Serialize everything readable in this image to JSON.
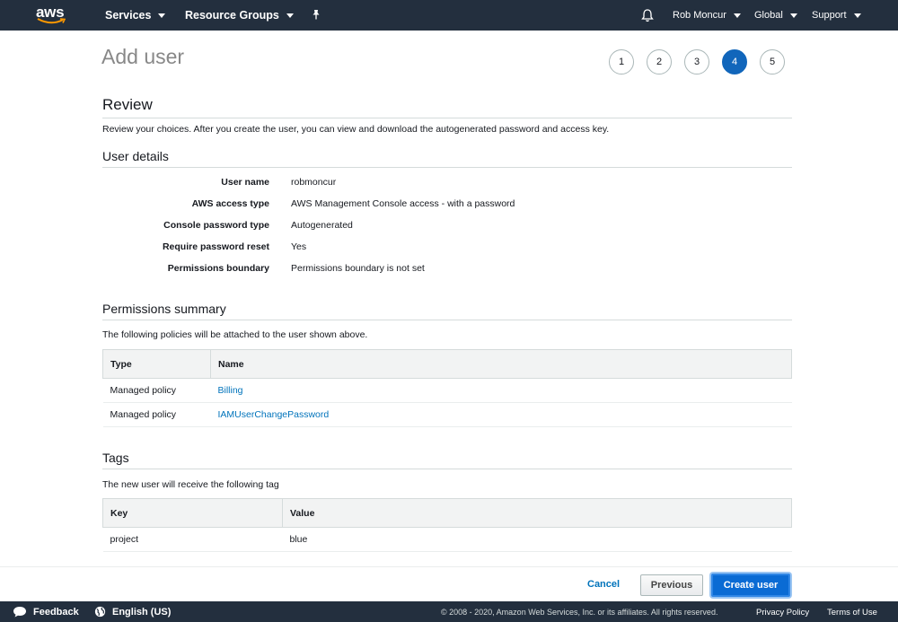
{
  "topnav": {
    "logo": "aws",
    "services": "Services",
    "resource_groups": "Resource Groups",
    "pin_icon": "pin-icon",
    "bell_icon": "bell-icon",
    "user": "Rob Moncur",
    "region": "Global",
    "support": "Support"
  },
  "page": {
    "title": "Add user",
    "steps": [
      "1",
      "2",
      "3",
      "4",
      "5"
    ],
    "active_step": "4"
  },
  "review": {
    "heading": "Review",
    "description": "Review your choices. After you create the user, you can view and download the autogenerated password and access key."
  },
  "user_details": {
    "heading": "User details",
    "rows": [
      {
        "label": "User name",
        "value": "robmoncur"
      },
      {
        "label": "AWS access type",
        "value": "AWS Management Console access - with a password"
      },
      {
        "label": "Console password type",
        "value": "Autogenerated"
      },
      {
        "label": "Require password reset",
        "value": "Yes"
      },
      {
        "label": "Permissions boundary",
        "value": "Permissions boundary is not set"
      }
    ]
  },
  "permissions": {
    "heading": "Permissions summary",
    "description": "The following policies will be attached to the user shown above.",
    "columns": [
      "Type",
      "Name"
    ],
    "rows": [
      {
        "type": "Managed policy",
        "name": "Billing"
      },
      {
        "type": "Managed policy",
        "name": "IAMUserChangePassword"
      }
    ]
  },
  "tags": {
    "heading": "Tags",
    "description": "The new user will receive the following tag",
    "columns": [
      "Key",
      "Value"
    ],
    "rows": [
      {
        "key": "project",
        "value": "blue"
      }
    ]
  },
  "actions": {
    "cancel": "Cancel",
    "previous": "Previous",
    "create": "Create user"
  },
  "footer": {
    "feedback": "Feedback",
    "language": "English (US)",
    "copyright": "© 2008 - 2020, Amazon Web Services, Inc. or its affiliates. All rights reserved.",
    "privacy": "Privacy Policy",
    "terms": "Terms of Use"
  },
  "colors": {
    "nav_bg": "#232f3e",
    "accent": "#1166bb",
    "link": "#0073bb",
    "logo_smile": "#ff9900"
  }
}
